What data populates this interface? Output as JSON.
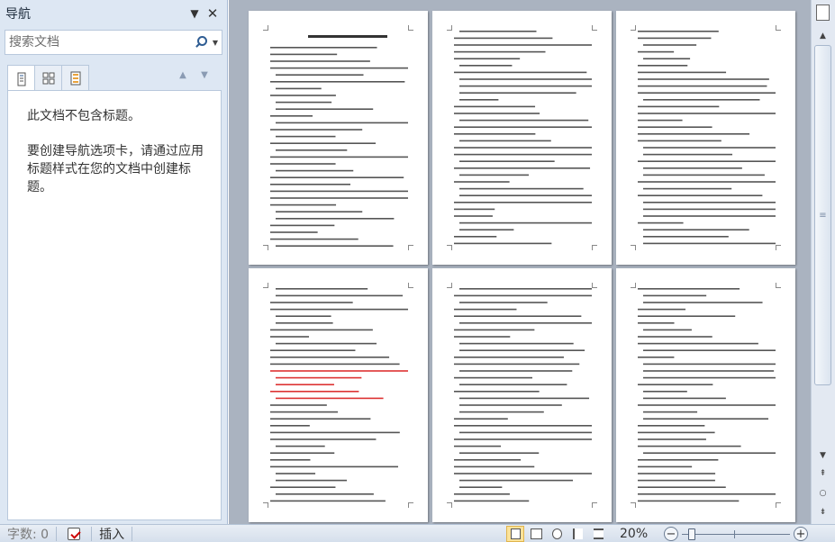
{
  "nav_pane": {
    "title": "导航",
    "search_placeholder": "搜索文档",
    "message_no_headings": "此文档不包含标题。",
    "message_instructions": "要创建导航选项卡，请通过应用标题样式在您的文档中创建标题。"
  },
  "status_bar": {
    "word_count": "字数: 0",
    "mode": "插入",
    "zoom": "20%"
  },
  "icons": {
    "dropdown": "chevron-down-icon",
    "close": "close-icon",
    "search": "search-icon",
    "pages_tab": "pages-icon",
    "headings_tab": "headings-icon",
    "results_tab": "results-icon"
  }
}
